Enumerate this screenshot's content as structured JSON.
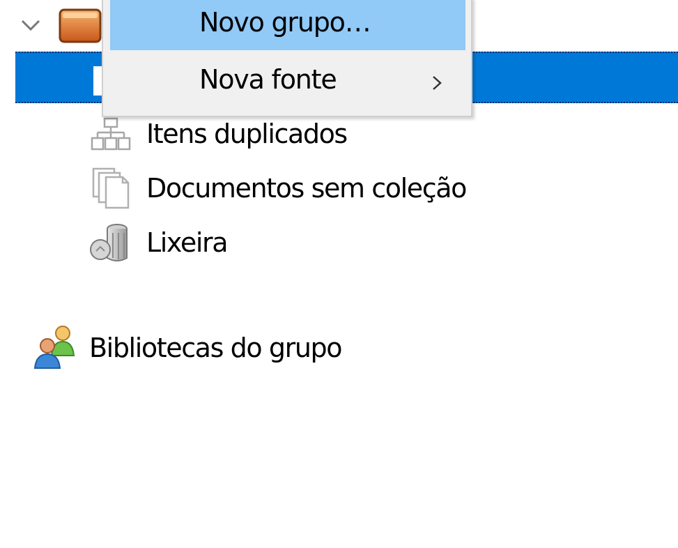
{
  "menu": {
    "items": [
      {
        "label": "Novo grupo…",
        "highlighted": true
      },
      {
        "label": "Nova fonte",
        "has_submenu": true
      }
    ]
  },
  "tree": {
    "items": [
      {
        "label": "Itens duplicados",
        "icon": "duplicate-items-icon"
      },
      {
        "label": "Documentos sem coleção",
        "icon": "unfiled-documents-icon"
      },
      {
        "label": "Lixeira",
        "icon": "trash-icon"
      }
    ],
    "group_libraries": {
      "label": "Bibliotecas do grupo",
      "icon": "group-libraries-icon"
    }
  },
  "colors": {
    "selection": "#0078d7",
    "menu_background": "#f0f0f0",
    "menu_highlight": "#91c9f7"
  }
}
